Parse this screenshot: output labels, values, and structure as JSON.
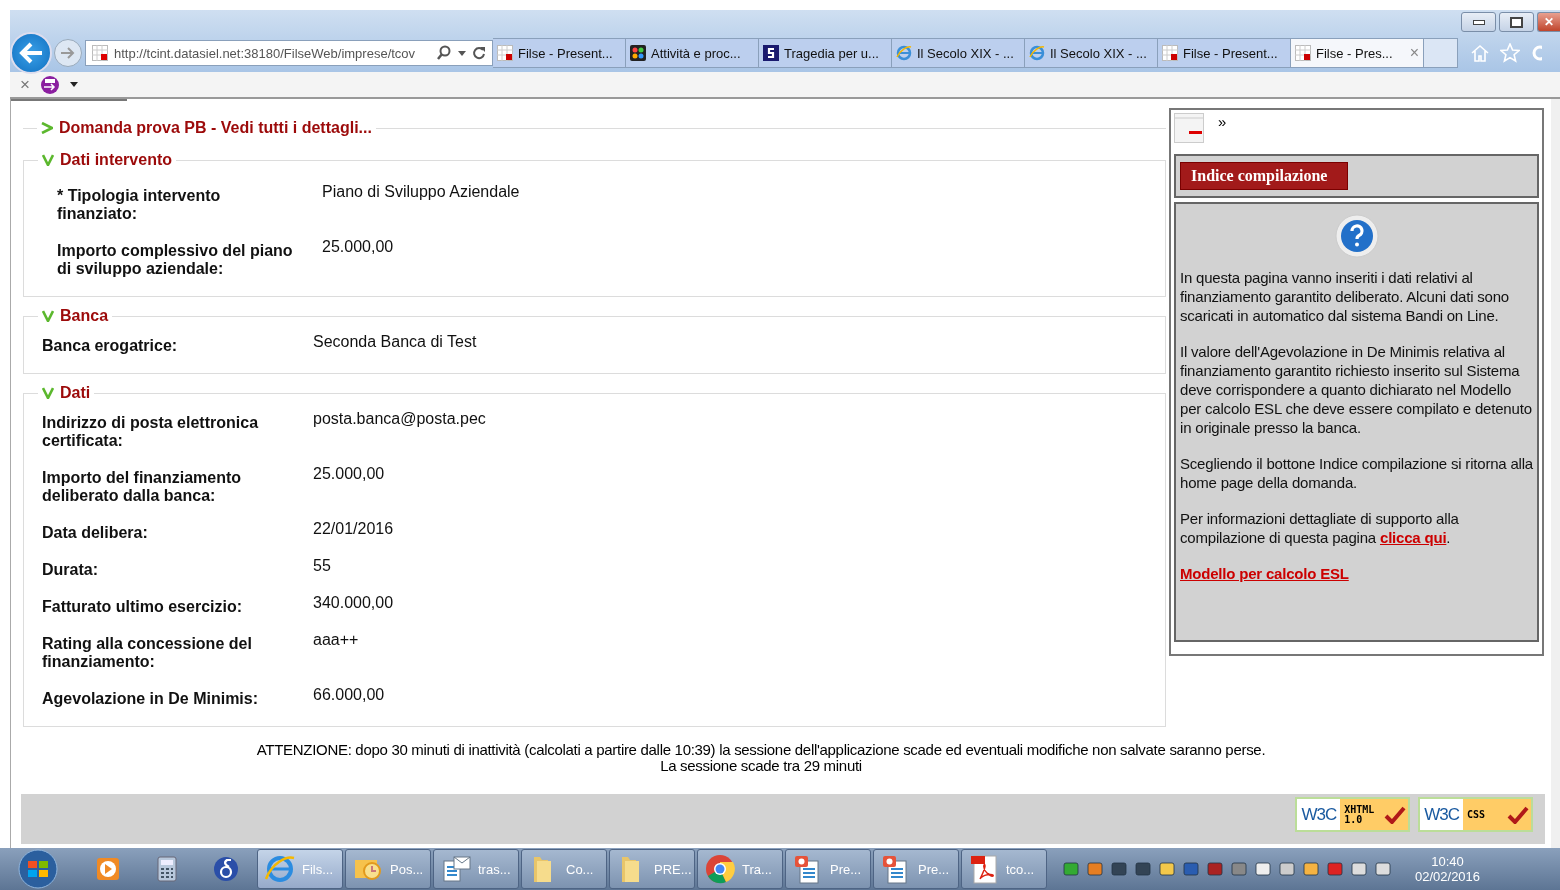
{
  "browser": {
    "address": "http://tcint.datasiel.net:38180/FilseWeb/imprese/tcov",
    "tabs": [
      {
        "label": "Filse - Present...",
        "selected": false
      },
      {
        "label": "Attività e proc...",
        "selected": false
      },
      {
        "label": "Tragedia per u...",
        "selected": false
      },
      {
        "label": "Il Secolo XIX - ...",
        "selected": false
      },
      {
        "label": "Il Secolo XIX - ...",
        "selected": false
      },
      {
        "label": "Filse - Present...",
        "selected": false
      },
      {
        "label": "Filse - Pres...",
        "selected": true
      }
    ],
    "close_tab": "×",
    "command_close": "×",
    "window_close": "✕"
  },
  "sections": [
    {
      "title": "Domanda prova PB - Vedi tutti i dettagli...",
      "expanded": false
    },
    {
      "title": "Dati intervento",
      "expanded": true,
      "nested": true,
      "fields": [
        {
          "label": "* Tipologia intervento finanziato:",
          "value": "Piano di Sviluppo Aziendale"
        },
        {
          "label": "Importo complessivo del piano di sviluppo aziendale:",
          "value": "25.000,00"
        }
      ]
    },
    {
      "title": "Banca",
      "expanded": true,
      "nested": false,
      "fields": [
        {
          "label": "Banca erogatrice:",
          "value": "Seconda Banca di Test"
        }
      ]
    },
    {
      "title": "Dati",
      "expanded": true,
      "nested": false,
      "fields": [
        {
          "label": "Indirizzo di posta elettronica certificata:",
          "value": "posta.banca@posta.pec"
        },
        {
          "label": "Importo del finanziamento deliberato dalla banca:",
          "value": "25.000,00"
        },
        {
          "label": "Data delibera:",
          "value": "22/01/2016"
        },
        {
          "label": "Durata:",
          "value": "55"
        },
        {
          "label": "Fatturato ultimo esercizio:",
          "value": "340.000,00"
        },
        {
          "label": "Rating alla concessione del finanziamento:",
          "value": "aaa++"
        },
        {
          "label": "Agevolazione in De Minimis:",
          "value": "66.000,00"
        }
      ]
    }
  ],
  "side_panel": {
    "toggle": "»",
    "index_button": "Indice compilazione",
    "paragraphs": [
      "In questa pagina vanno inseriti i dati relativi al finanziamento garantito deliberato. Alcuni dati sono scaricati in automatico dal sistema Bandi on Line.",
      "Il valore dell'Agevolazione in De Minimis relativa al finanziamento garantito richiesto inserito sul Sistema deve corrispondere a quanto dichiarato nel Modello per calcolo ESL che deve essere compilato e detenuto in originale presso la banca.",
      "Scegliendo il bottone Indice compilazione si ritorna alla home page della domanda."
    ],
    "support": {
      "before": "Per informazioni dettagliate di supporto alla compilazione di questa pagina ",
      "link": "clicca qui",
      "after": "."
    },
    "model_link": "Modello per calcolo ESL"
  },
  "notice": "ATTENZIONE: dopo 30 minuti di inattività (calcolati a partire dalle 10:39) la sessione dell'applicazione scade ed eventuali modifiche non salvate saranno perse.",
  "session": "La sessione scade tra 29 minuti",
  "badges": [
    {
      "logo": "W3C",
      "label": "XHTML 1.0"
    },
    {
      "logo": "W3C",
      "label": "CSS"
    }
  ],
  "taskbar": {
    "windows": [
      {
        "label": "Fils...",
        "selected": true
      },
      {
        "label": "Pos...",
        "selected": false
      },
      {
        "label": "tras...",
        "selected": false
      },
      {
        "label": "Co...",
        "selected": false
      },
      {
        "label": "PRE...",
        "selected": false
      },
      {
        "label": "Tra...",
        "selected": false
      },
      {
        "label": "Pre...",
        "selected": false
      },
      {
        "label": "Pre...",
        "selected": false
      },
      {
        "label": "tco...",
        "selected": false
      }
    ],
    "time": "10:40",
    "date": "02/02/2016"
  }
}
